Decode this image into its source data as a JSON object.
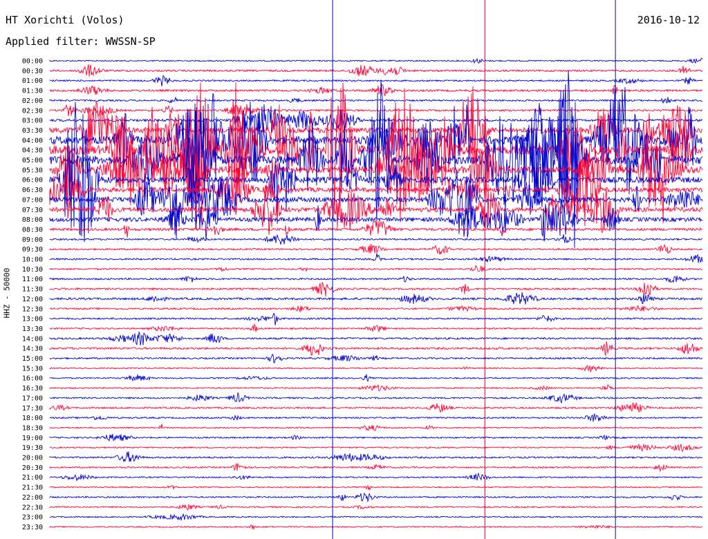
{
  "header": {
    "station": "HT Xorichti (Volos)",
    "date": "2016-10-12",
    "filter": "Applied filter: WWSSN-SP"
  },
  "chart_data": {
    "type": "line",
    "subtype": "helicorder",
    "ylabel": "HHZ - 50000",
    "trace_labels": [
      "00:00",
      "00:30",
      "01:00",
      "01:30",
      "02:00",
      "02:30",
      "03:00",
      "03:30",
      "04:00",
      "04:30",
      "05:00",
      "05:30",
      "06:00",
      "06:30",
      "07:00",
      "07:30",
      "08:00",
      "08:30",
      "09:00",
      "09:30",
      "10:00",
      "10:30",
      "11:00",
      "11:30",
      "12:00",
      "12:30",
      "13:00",
      "13:30",
      "14:00",
      "14:30",
      "15:00",
      "15:30",
      "16:00",
      "16:30",
      "17:00",
      "17:30",
      "18:00",
      "18:30",
      "19:00",
      "19:30",
      "20:00",
      "20:30",
      "21:00",
      "21:30",
      "22:00",
      "22:30",
      "23:00",
      "23:30"
    ],
    "colors": {
      "even": "#0000cc",
      "odd": "#ff0033",
      "marker_red": "#cc0033",
      "marker_blue": "#0000aa"
    },
    "minute_markers": [
      {
        "minute": 13,
        "color": "blue"
      },
      {
        "minute": 20,
        "color": "red"
      },
      {
        "minute": 26,
        "color": "blue"
      }
    ],
    "trace_activity": [
      0.05,
      0.12,
      0.08,
      0.14,
      0.1,
      0.12,
      0.18,
      0.55,
      0.85,
      0.95,
      0.9,
      0.75,
      0.6,
      0.45,
      0.5,
      0.45,
      0.4,
      0.2,
      0.1,
      0.1,
      0.1,
      0.08,
      0.1,
      0.12,
      0.15,
      0.1,
      0.1,
      0.08,
      0.12,
      0.14,
      0.1,
      0.05,
      0.06,
      0.06,
      0.08,
      0.1,
      0.08,
      0.06,
      0.08,
      0.06,
      0.1,
      0.08,
      0.06,
      0.05,
      0.08,
      0.06,
      0.05,
      0.05
    ]
  }
}
